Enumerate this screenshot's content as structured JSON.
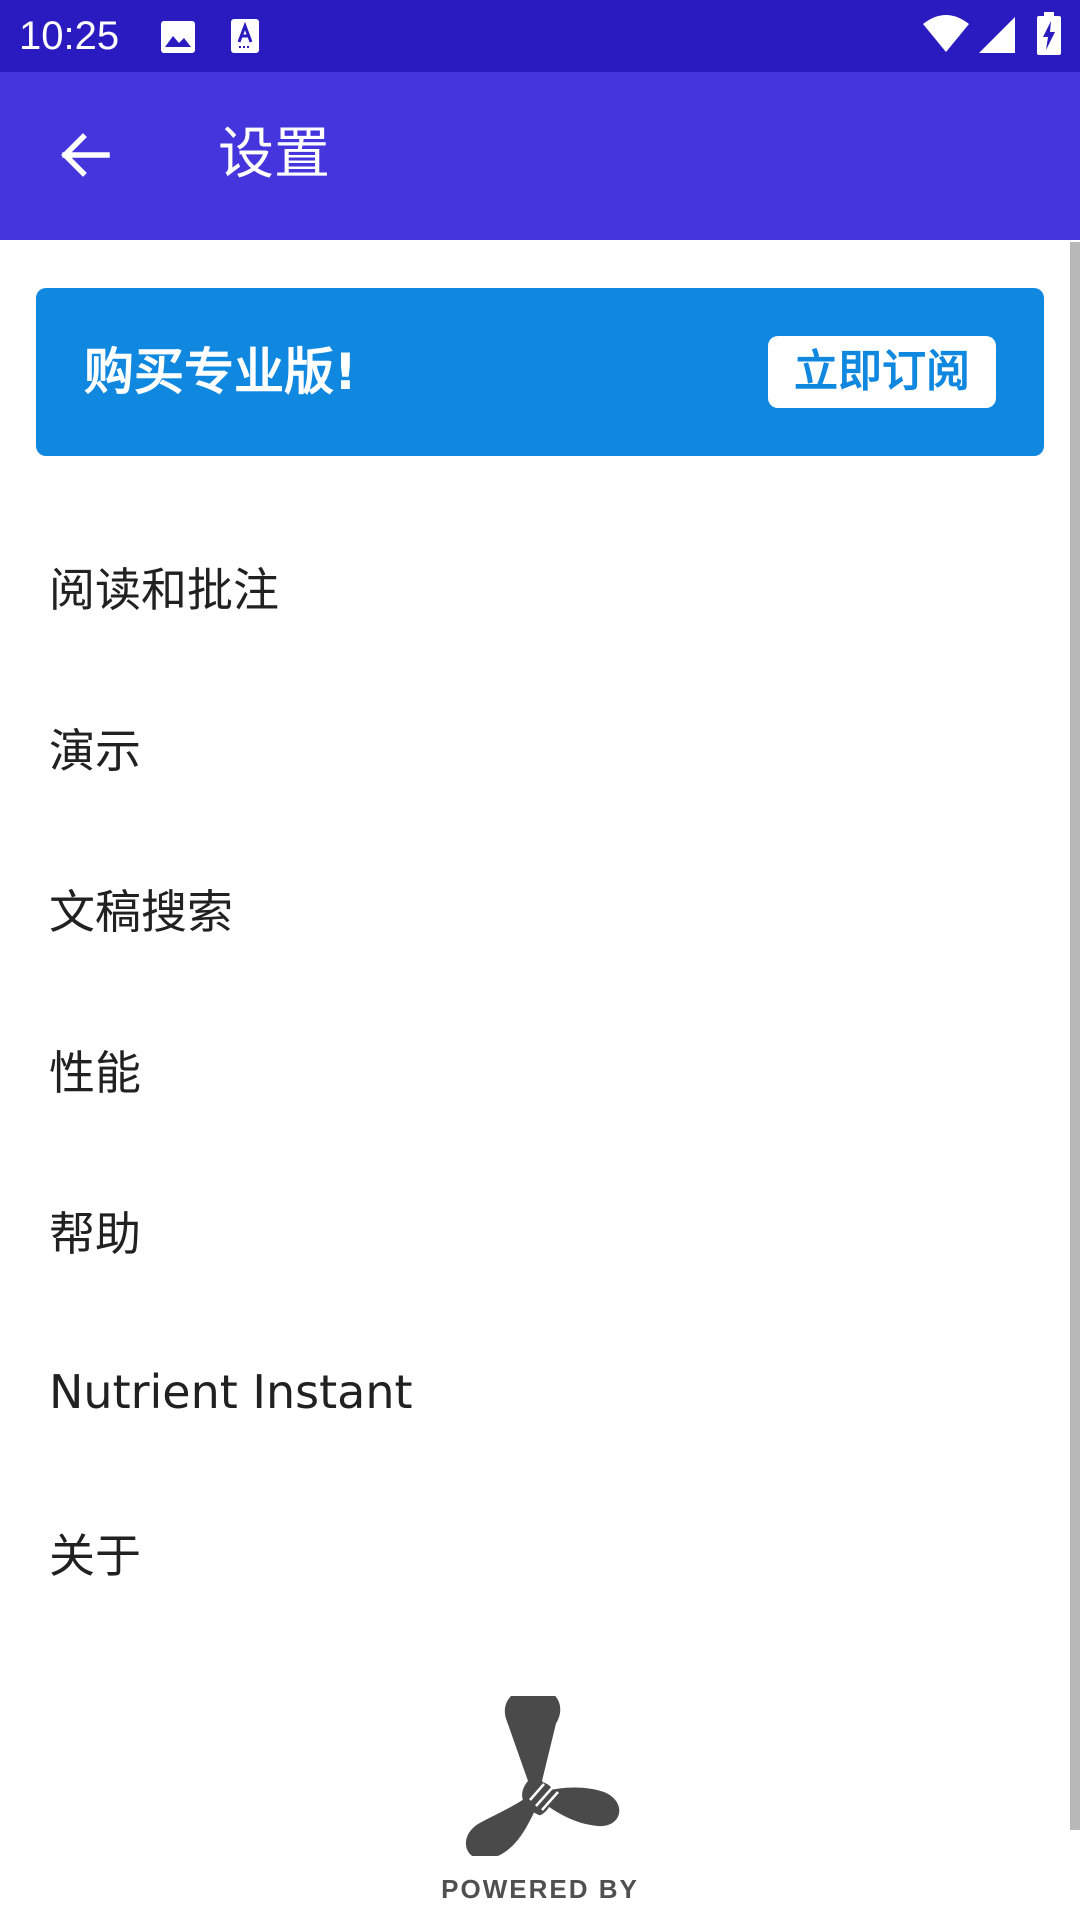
{
  "status_bar": {
    "time": "10:25",
    "left_icons": [
      "image-icon",
      "text-a-icon"
    ],
    "right_icons": [
      "wifi-icon",
      "cellular-signal-icon",
      "battery-charging-icon"
    ],
    "background": "#2a1bc0"
  },
  "app_bar": {
    "title": "设置",
    "back_icon": "arrow-back-icon",
    "background": "#4535dc"
  },
  "promo": {
    "text": "购买专业版!",
    "button_label": "立即订阅",
    "background": "#1088e0"
  },
  "settings": {
    "items": [
      {
        "label": "阅读和批注"
      },
      {
        "label": "演示"
      },
      {
        "label": "文稿搜索"
      },
      {
        "label": "性能"
      },
      {
        "label": "帮助"
      },
      {
        "label": "Nutrient Instant"
      },
      {
        "label": "关于"
      }
    ]
  },
  "footer": {
    "powered_by": "POWERED BY",
    "logo_icon": "pspdfkit-logo-icon"
  }
}
